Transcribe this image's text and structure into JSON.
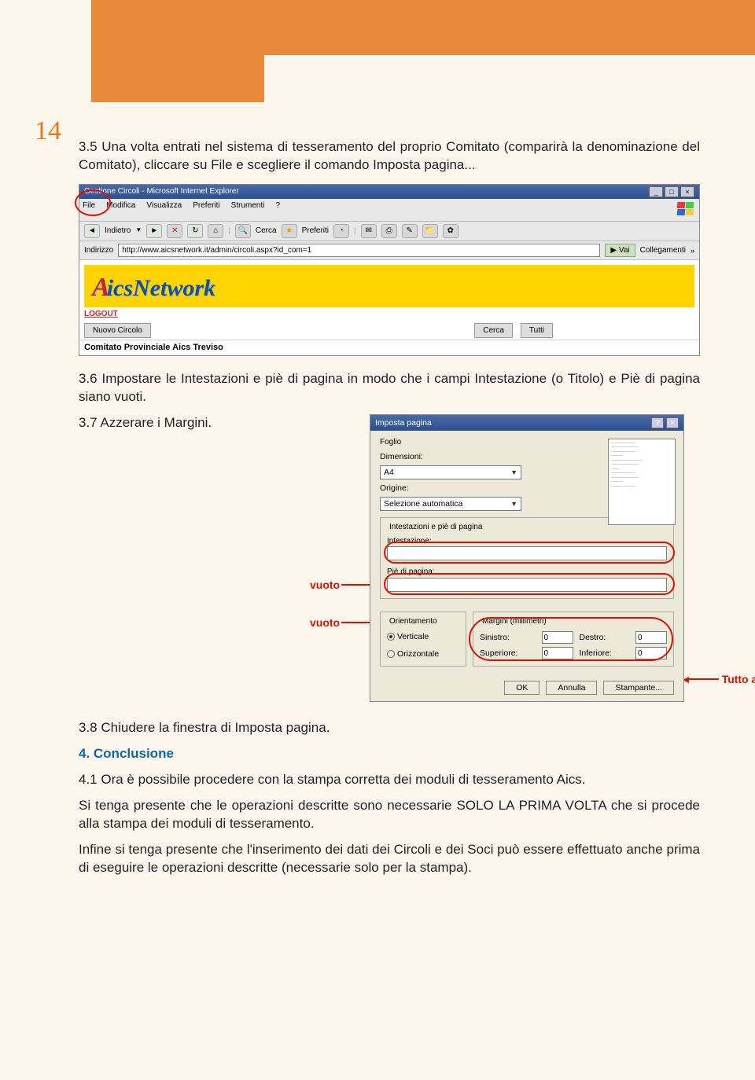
{
  "page_number": "14",
  "para35": "3.5 Una volta entrati nel sistema di tesseramento del proprio Comitato (comparirà la denominazione del Comitato), cliccare su File e scegliere il comando Imposta pagina...",
  "browser": {
    "title": "Gestione Circoli - Microsoft Internet Explorer",
    "menu": {
      "file": "File",
      "modifica": "Modifica",
      "visualizza": "Visualizza",
      "preferiti": "Preferiti",
      "strumenti": "Strumenti",
      "help": "?"
    },
    "toolbar": {
      "indietro": "Indietro",
      "cerca": "Cerca",
      "preferiti": "Preferiti"
    },
    "addr_label": "Indirizzo",
    "url": "http://www.aicsnetwork.it/admin/circoli.aspx?id_com=1",
    "go": "Vai",
    "links_label": "Collegamenti",
    "logo": "AicsNetwork",
    "logout": "LOGOUT",
    "nuovo": "Nuovo Circolo",
    "cerca_btn": "Cerca",
    "tutti": "Tutti",
    "comitato": "Comitato Provinciale Aics Treviso"
  },
  "para36": "3.6 Impostare le Intestazioni e piè di pagina in modo che i campi Intestazione (o Titolo) e Piè di pagina siano vuoti.",
  "para37": "3.7 Azzerare i Margini.",
  "dialog": {
    "title": "Imposta pagina",
    "foglio": "Foglio",
    "dimensioni": "Dimensioni:",
    "dim_val": "A4",
    "origine": "Origine:",
    "orig_val": "Selezione automatica",
    "intest_group": "Intestazioni e piè di pagina",
    "intest": "Intestazione:",
    "pie": "Piè di pagina:",
    "orient_group": "Orientamento",
    "vert": "Verticale",
    "oriz": "Orizzontale",
    "marg_group": "Margini (millimetri)",
    "sin": "Sinistro:",
    "des": "Destro:",
    "sup": "Superiore:",
    "inf": "Inferiore:",
    "sin_v": "0",
    "des_v": "0",
    "sup_v": "0",
    "inf_v": "0",
    "ok": "OK",
    "annulla": "Annulla",
    "stampante": "Stampante..."
  },
  "annot": {
    "vuoto": "vuoto",
    "zero": "Tutto a zero"
  },
  "para38": "3.8 Chiudere la finestra di Imposta pagina.",
  "sec4_title": "4. Conclusione",
  "para41": "4.1 Ora è possibile procedere con la stampa corretta dei moduli di tesseramento Aics.",
  "para_note1": "Si tenga presente che le operazioni descritte sono necessarie SOLO LA PRIMA VOLTA che si procede alla stampa dei moduli di tesseramento.",
  "para_note2": "Infine si tenga presente che l'inserimento dei dati dei Circoli e dei Soci può essere effettuato anche prima di eseguire le operazioni descritte (necessarie solo per la stampa)."
}
